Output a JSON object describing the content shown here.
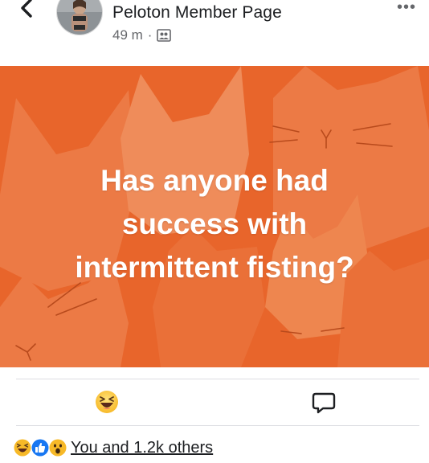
{
  "header": {
    "group_name": "Peloton Member Page",
    "time_ago": "49 m",
    "separator": "·",
    "audience_icon": "group-audience-icon",
    "back_icon": "chevron-left-icon",
    "more_label": "•••"
  },
  "post": {
    "background_color": "#e8652b",
    "text_line_1": "Has anyone had",
    "text_line_2": "success with",
    "text_line_3": "intermittent fisting?"
  },
  "actions": {
    "react_icon": "laughing-emoji-icon",
    "comment_icon": "comment-bubble-icon"
  },
  "reactions": {
    "icons": [
      "haha-reaction-icon",
      "like-reaction-icon",
      "wow-reaction-icon"
    ],
    "summary_text": "You and 1.2k others"
  }
}
